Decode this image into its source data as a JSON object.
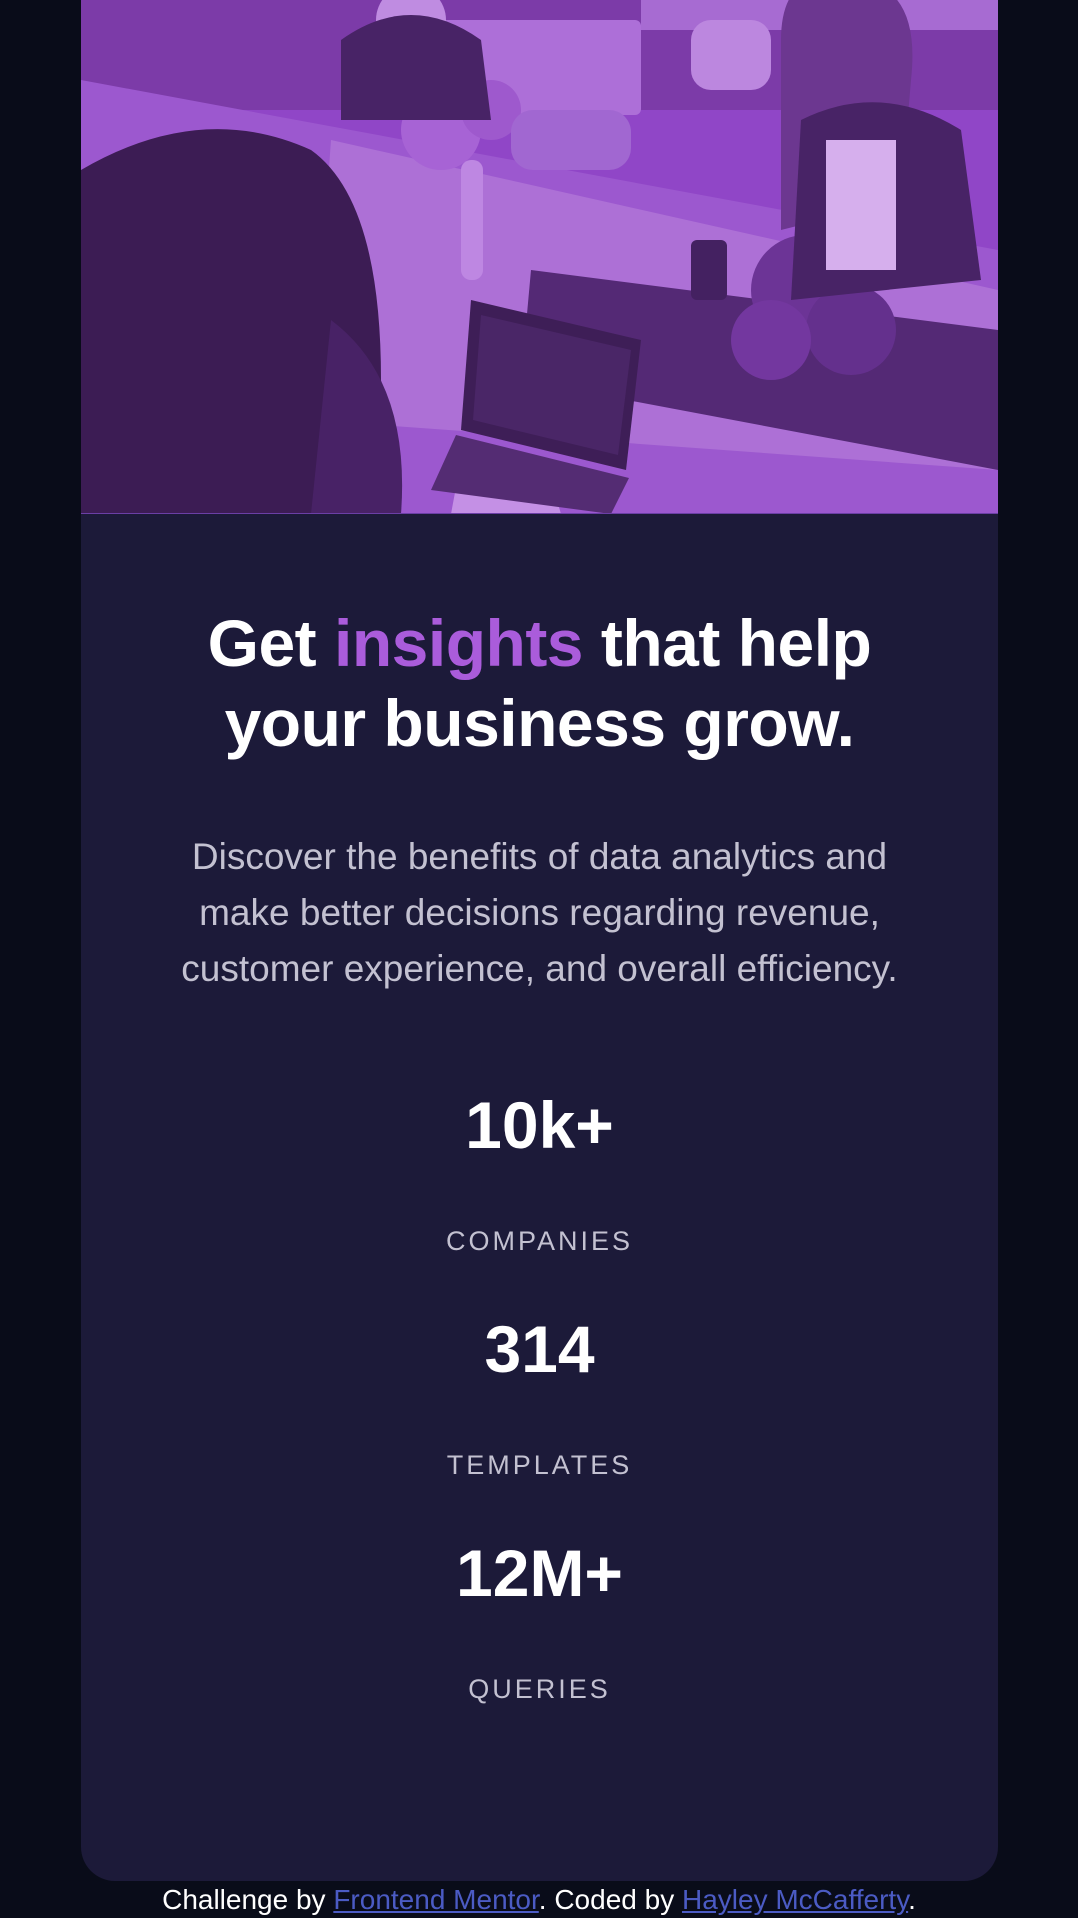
{
  "hero": {
    "image_alt": "People working at a table with laptops, purple tinted",
    "tint_color": "#a24fd8"
  },
  "headline": {
    "part1": "Get ",
    "accent": "insights",
    "part2": " that help your business grow."
  },
  "description": "Discover the benefits of data analytics and make better decisions regarding revenue, customer experience, and overall efficiency.",
  "stats": [
    {
      "value": "10k+",
      "label": "COMPANIES"
    },
    {
      "value": "314",
      "label": "TEMPLATES"
    },
    {
      "value": "12M+",
      "label": "QUERIES"
    }
  ],
  "footer": {
    "prefix": "Challenge by ",
    "link1": "Frontend Mentor",
    "middle": ". Coded by ",
    "link2": "Hayley McCafferty",
    "suffix": "."
  },
  "colors": {
    "page_bg": "#090c19",
    "card_bg": "#1c1a39",
    "accent": "#aa5cdb",
    "text_muted": "#c3c1d1",
    "link": "#4b5bc4"
  }
}
